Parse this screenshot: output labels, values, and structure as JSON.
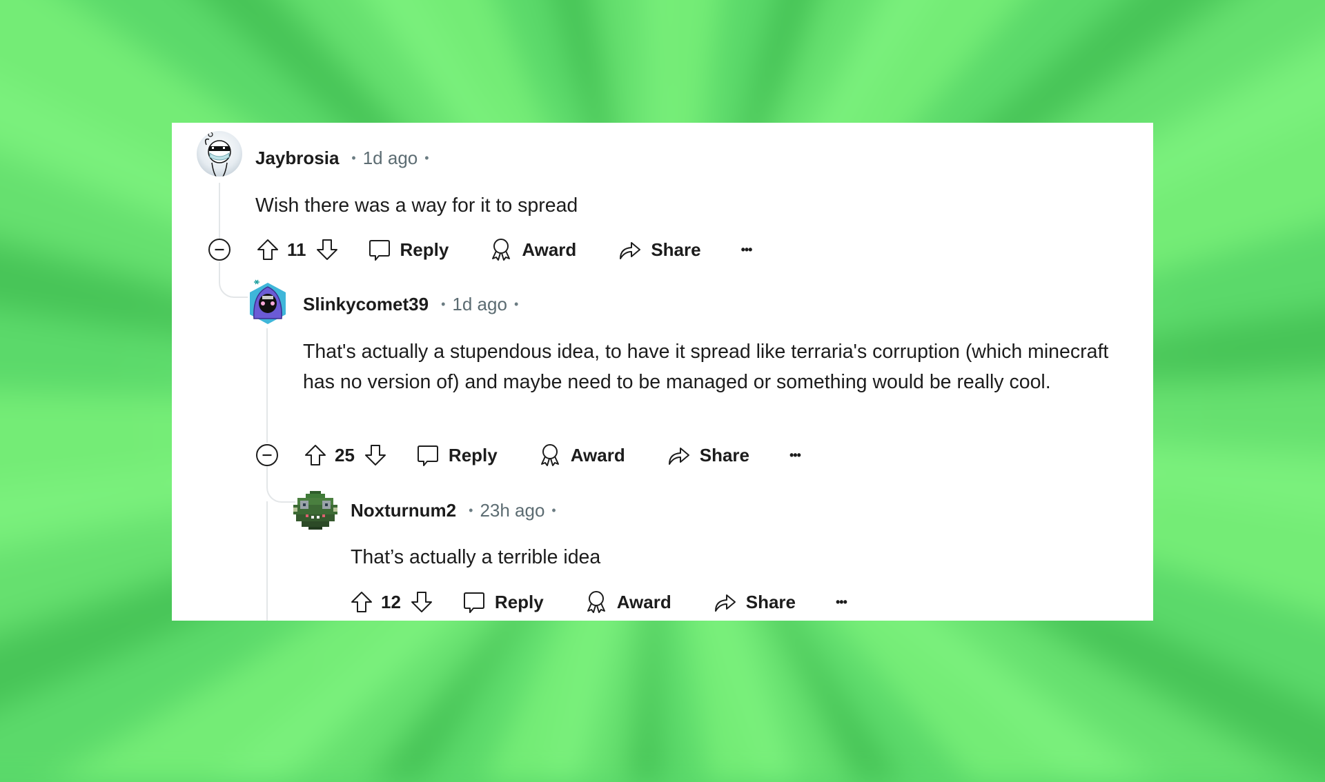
{
  "comments": [
    {
      "username": "Jaybrosia",
      "time": "1d ago",
      "separator": "•",
      "body": "Wish there was a way for it to spread",
      "votes": "11",
      "actions": {
        "reply": "Reply",
        "award": "Award",
        "share": "Share",
        "more": "•••"
      },
      "avatar_icon": "snoo-sunglasses-mask-avatar",
      "collapsible": true
    },
    {
      "username": "Slinkycomet39",
      "time": "1d ago",
      "separator": "•",
      "body": "That's actually a stupendous idea, to have it spread like terraria's corruption (which minecraft has no version of) and maybe need to be managed or something would be really cool.",
      "votes": "25",
      "actions": {
        "reply": "Reply",
        "award": "Award",
        "share": "Share",
        "more": "•••"
      },
      "avatar_icon": "purple-hooded-figure-avatar",
      "collapsible": true
    },
    {
      "username": "Noxturnum2",
      "time": "23h ago",
      "separator": "•",
      "body": "That’s actually a terrible idea",
      "votes": "12",
      "actions": {
        "reply": "Reply",
        "award": "Award",
        "share": "Share",
        "more": "•••"
      },
      "avatar_icon": "pixel-green-creature-avatar",
      "collapsible": false
    }
  ],
  "colors": {
    "text": "#1c1c1c",
    "meta": "#5c6c72",
    "thread_line": "#e3e6e8",
    "background_green": "#5bd96a",
    "card": "#ffffff"
  }
}
